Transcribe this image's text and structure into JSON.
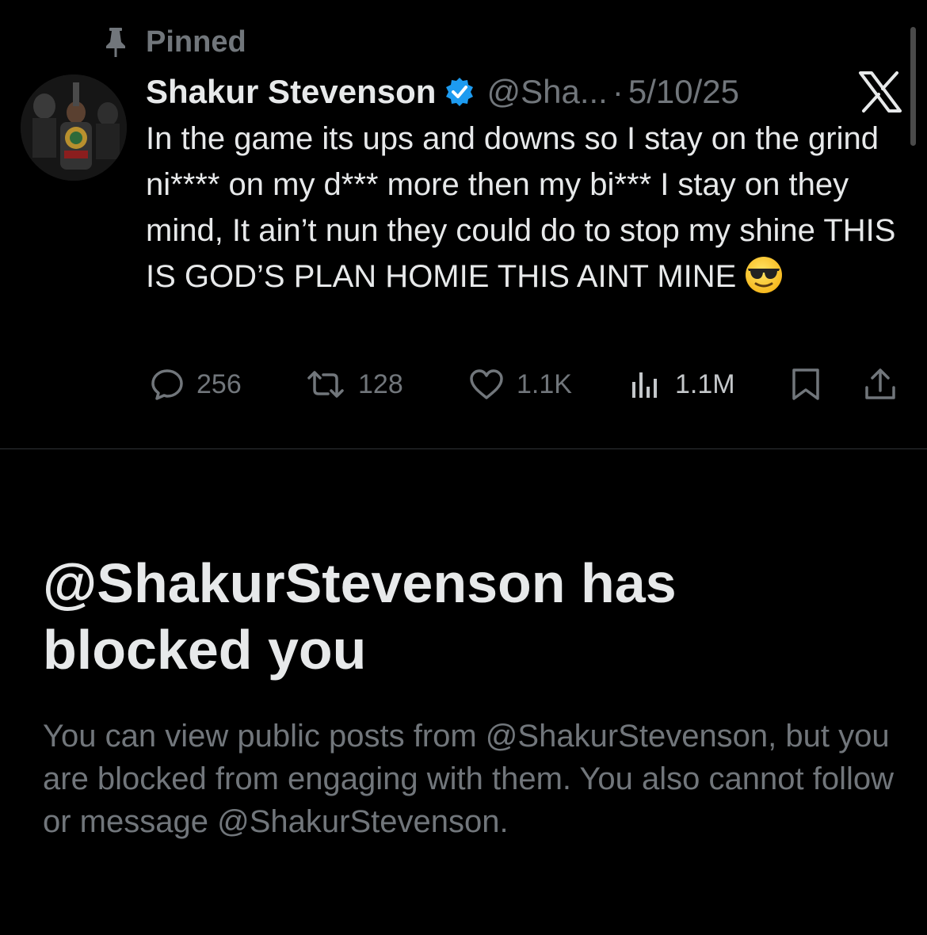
{
  "pinned": {
    "label": "Pinned",
    "icon": "pin-icon"
  },
  "tweet": {
    "display_name": "Shakur Stevenson",
    "verified_icon": "verified-badge-icon",
    "handle": "@Sha...",
    "separator": "·",
    "date": "5/10/25",
    "text": "In the game its ups and downs so I stay on the grind ni**** on my d*** more then my bi*** I stay on they mind, It ain’t nun they could do to stop my shine THIS IS GOD’S PLAN HOMIE THIS AINT MINE",
    "emoji": "smiling-face-with-sunglasses",
    "actions": {
      "replies": "256",
      "reposts": "128",
      "likes": "1.1K",
      "views": "1.1M"
    }
  },
  "blocked": {
    "title": "@ShakurStevenson has blocked you",
    "description": "You can view public posts from @ShakurStevenson, but you are blocked from engaging with them. You also cannot follow or message @ShakurStevenson."
  },
  "colors": {
    "background": "#000000",
    "primary_text": "#e7e9ea",
    "secondary_text": "#71767b",
    "verified_blue": "#1d9bf0",
    "divider": "#2f3336"
  }
}
